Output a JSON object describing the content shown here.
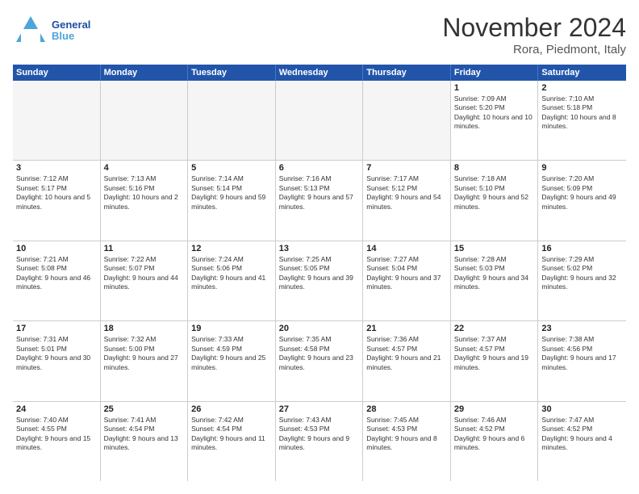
{
  "header": {
    "logo_general": "General",
    "logo_blue": "Blue",
    "month": "November 2024",
    "location": "Rora, Piedmont, Italy"
  },
  "weekdays": [
    "Sunday",
    "Monday",
    "Tuesday",
    "Wednesday",
    "Thursday",
    "Friday",
    "Saturday"
  ],
  "rows": [
    [
      {
        "day": "",
        "text": "",
        "empty": true
      },
      {
        "day": "",
        "text": "",
        "empty": true
      },
      {
        "day": "",
        "text": "",
        "empty": true
      },
      {
        "day": "",
        "text": "",
        "empty": true
      },
      {
        "day": "",
        "text": "",
        "empty": true
      },
      {
        "day": "1",
        "text": "Sunrise: 7:09 AM\nSunset: 5:20 PM\nDaylight: 10 hours and 10 minutes."
      },
      {
        "day": "2",
        "text": "Sunrise: 7:10 AM\nSunset: 5:18 PM\nDaylight: 10 hours and 8 minutes."
      }
    ],
    [
      {
        "day": "3",
        "text": "Sunrise: 7:12 AM\nSunset: 5:17 PM\nDaylight: 10 hours and 5 minutes."
      },
      {
        "day": "4",
        "text": "Sunrise: 7:13 AM\nSunset: 5:16 PM\nDaylight: 10 hours and 2 minutes."
      },
      {
        "day": "5",
        "text": "Sunrise: 7:14 AM\nSunset: 5:14 PM\nDaylight: 9 hours and 59 minutes."
      },
      {
        "day": "6",
        "text": "Sunrise: 7:16 AM\nSunset: 5:13 PM\nDaylight: 9 hours and 57 minutes."
      },
      {
        "day": "7",
        "text": "Sunrise: 7:17 AM\nSunset: 5:12 PM\nDaylight: 9 hours and 54 minutes."
      },
      {
        "day": "8",
        "text": "Sunrise: 7:18 AM\nSunset: 5:10 PM\nDaylight: 9 hours and 52 minutes."
      },
      {
        "day": "9",
        "text": "Sunrise: 7:20 AM\nSunset: 5:09 PM\nDaylight: 9 hours and 49 minutes."
      }
    ],
    [
      {
        "day": "10",
        "text": "Sunrise: 7:21 AM\nSunset: 5:08 PM\nDaylight: 9 hours and 46 minutes."
      },
      {
        "day": "11",
        "text": "Sunrise: 7:22 AM\nSunset: 5:07 PM\nDaylight: 9 hours and 44 minutes."
      },
      {
        "day": "12",
        "text": "Sunrise: 7:24 AM\nSunset: 5:06 PM\nDaylight: 9 hours and 41 minutes."
      },
      {
        "day": "13",
        "text": "Sunrise: 7:25 AM\nSunset: 5:05 PM\nDaylight: 9 hours and 39 minutes."
      },
      {
        "day": "14",
        "text": "Sunrise: 7:27 AM\nSunset: 5:04 PM\nDaylight: 9 hours and 37 minutes."
      },
      {
        "day": "15",
        "text": "Sunrise: 7:28 AM\nSunset: 5:03 PM\nDaylight: 9 hours and 34 minutes."
      },
      {
        "day": "16",
        "text": "Sunrise: 7:29 AM\nSunset: 5:02 PM\nDaylight: 9 hours and 32 minutes."
      }
    ],
    [
      {
        "day": "17",
        "text": "Sunrise: 7:31 AM\nSunset: 5:01 PM\nDaylight: 9 hours and 30 minutes."
      },
      {
        "day": "18",
        "text": "Sunrise: 7:32 AM\nSunset: 5:00 PM\nDaylight: 9 hours and 27 minutes."
      },
      {
        "day": "19",
        "text": "Sunrise: 7:33 AM\nSunset: 4:59 PM\nDaylight: 9 hours and 25 minutes."
      },
      {
        "day": "20",
        "text": "Sunrise: 7:35 AM\nSunset: 4:58 PM\nDaylight: 9 hours and 23 minutes."
      },
      {
        "day": "21",
        "text": "Sunrise: 7:36 AM\nSunset: 4:57 PM\nDaylight: 9 hours and 21 minutes."
      },
      {
        "day": "22",
        "text": "Sunrise: 7:37 AM\nSunset: 4:57 PM\nDaylight: 9 hours and 19 minutes."
      },
      {
        "day": "23",
        "text": "Sunrise: 7:38 AM\nSunset: 4:56 PM\nDaylight: 9 hours and 17 minutes."
      }
    ],
    [
      {
        "day": "24",
        "text": "Sunrise: 7:40 AM\nSunset: 4:55 PM\nDaylight: 9 hours and 15 minutes."
      },
      {
        "day": "25",
        "text": "Sunrise: 7:41 AM\nSunset: 4:54 PM\nDaylight: 9 hours and 13 minutes."
      },
      {
        "day": "26",
        "text": "Sunrise: 7:42 AM\nSunset: 4:54 PM\nDaylight: 9 hours and 11 minutes."
      },
      {
        "day": "27",
        "text": "Sunrise: 7:43 AM\nSunset: 4:53 PM\nDaylight: 9 hours and 9 minutes."
      },
      {
        "day": "28",
        "text": "Sunrise: 7:45 AM\nSunset: 4:53 PM\nDaylight: 9 hours and 8 minutes."
      },
      {
        "day": "29",
        "text": "Sunrise: 7:46 AM\nSunset: 4:52 PM\nDaylight: 9 hours and 6 minutes."
      },
      {
        "day": "30",
        "text": "Sunrise: 7:47 AM\nSunset: 4:52 PM\nDaylight: 9 hours and 4 minutes."
      }
    ]
  ]
}
